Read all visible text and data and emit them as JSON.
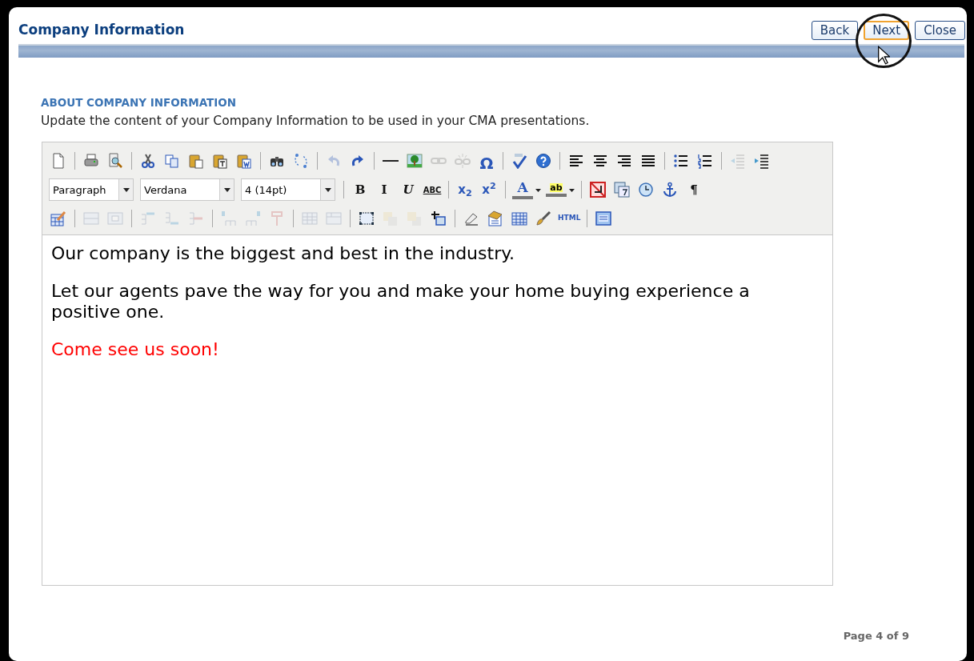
{
  "header": {
    "title": "Company Information",
    "buttons": [
      {
        "label": "Back",
        "focused": false
      },
      {
        "label": "Next",
        "focused": true
      },
      {
        "label": "Close",
        "focused": false
      }
    ]
  },
  "section": {
    "heading": "ABOUT COMPANY INFORMATION",
    "description": "Update the content of your Company Information to be used in your CMA presentations."
  },
  "toolbar_rows": [
    [
      {
        "kind": "icon",
        "disabled": false
      },
      {
        "kind": "separator"
      },
      {
        "kind": "icon",
        "disabled": false
      },
      {
        "kind": "icon",
        "disabled": false
      },
      {
        "kind": "separator"
      },
      {
        "kind": "icon",
        "disabled": false
      },
      {
        "kind": "icon",
        "disabled": false
      },
      {
        "kind": "icon",
        "disabled": false
      },
      {
        "kind": "icon",
        "disabled": false
      },
      {
        "kind": "icon",
        "disabled": false
      },
      {
        "kind": "separator"
      },
      {
        "kind": "icon",
        "disabled": false
      },
      {
        "kind": "icon",
        "disabled": false
      },
      {
        "kind": "separator"
      },
      {
        "kind": "icon",
        "disabled": true
      },
      {
        "kind": "icon",
        "disabled": false
      },
      {
        "kind": "separator"
      },
      {
        "kind": "icon",
        "disabled": false
      },
      {
        "kind": "icon",
        "disabled": false
      },
      {
        "kind": "icon",
        "disabled": true
      },
      {
        "kind": "icon",
        "disabled": true
      },
      {
        "kind": "glyph",
        "label": "Ω",
        "disabled": false
      },
      {
        "kind": "separator"
      },
      {
        "kind": "icon",
        "disabled": false
      },
      {
        "kind": "icon",
        "disabled": false
      },
      {
        "kind": "separator"
      },
      {
        "kind": "icon",
        "disabled": false
      },
      {
        "kind": "icon",
        "disabled": false
      },
      {
        "kind": "icon",
        "disabled": false
      },
      {
        "kind": "icon",
        "disabled": false
      },
      {
        "kind": "separator"
      },
      {
        "kind": "icon",
        "disabled": false
      },
      {
        "kind": "icon",
        "disabled": false
      },
      {
        "kind": "separator"
      },
      {
        "kind": "icon",
        "disabled": true
      },
      {
        "kind": "icon",
        "disabled": false
      }
    ],
    [
      {
        "kind": "select",
        "value": "Paragraph"
      },
      {
        "kind": "select",
        "value": "Verdana"
      },
      {
        "kind": "select",
        "value": "4 (14pt)"
      },
      {
        "kind": "separator"
      },
      {
        "kind": "glyph",
        "label": "B",
        "disabled": false
      },
      {
        "kind": "glyph",
        "label": "I",
        "disabled": false
      },
      {
        "kind": "glyph",
        "label": "U",
        "disabled": false
      },
      {
        "kind": "glyph",
        "label": "ABC",
        "disabled": false
      },
      {
        "kind": "separator"
      },
      {
        "kind": "glyph",
        "label": "x$_{2}$",
        "disabled": false
      },
      {
        "kind": "glyph",
        "label": "x$^{2}$",
        "disabled": false
      },
      {
        "kind": "separator"
      },
      {
        "kind": "color",
        "label": "A",
        "disabled": false
      },
      {
        "kind": "color",
        "label": "ab",
        "disabled": false
      },
      {
        "kind": "separator"
      },
      {
        "kind": "icon",
        "disabled": false
      },
      {
        "kind": "icon",
        "disabled": false
      },
      {
        "kind": "icon",
        "disabled": false
      },
      {
        "kind": "icon",
        "disabled": false
      },
      {
        "kind": "glyph",
        "label": "¶",
        "disabled": false
      }
    ],
    [
      {
        "kind": "icon",
        "disabled": false
      },
      {
        "kind": "separator"
      },
      {
        "kind": "icon",
        "disabled": true
      },
      {
        "kind": "icon",
        "disabled": true
      },
      {
        "kind": "separator"
      },
      {
        "kind": "icon",
        "disabled": true
      },
      {
        "kind": "icon",
        "disabled": true
      },
      {
        "kind": "icon",
        "disabled": true
      },
      {
        "kind": "separator"
      },
      {
        "kind": "icon",
        "disabled": true
      },
      {
        "kind": "icon",
        "disabled": true
      },
      {
        "kind": "icon",
        "disabled": true
      },
      {
        "kind": "separator"
      },
      {
        "kind": "icon",
        "disabled": true
      },
      {
        "kind": "icon",
        "disabled": true
      },
      {
        "kind": "separator"
      },
      {
        "kind": "icon",
        "disabled": false
      },
      {
        "kind": "icon",
        "disabled": true
      },
      {
        "kind": "icon",
        "disabled": true
      },
      {
        "kind": "icon",
        "disabled": false
      },
      {
        "kind": "separator"
      },
      {
        "kind": "icon",
        "disabled": false
      },
      {
        "kind": "icon",
        "disabled": false
      },
      {
        "kind": "icon",
        "disabled": false
      },
      {
        "kind": "icon",
        "disabled": false
      },
      {
        "kind": "glyph",
        "label": "HTML",
        "disabled": false
      },
      {
        "kind": "separator"
      },
      {
        "kind": "icon",
        "disabled": false
      }
    ]
  ],
  "content": [
    {
      "text": "Our company is the biggest and best in the industry.",
      "color": "#000000"
    },
    {
      "text": "Let our agents pave the way for you and make your home buying experience a positive one.",
      "color": "#000000"
    },
    {
      "text": "Come see us soon!",
      "color": "#ff0000"
    }
  ],
  "footer": {
    "page": "Page 4 of 9"
  }
}
